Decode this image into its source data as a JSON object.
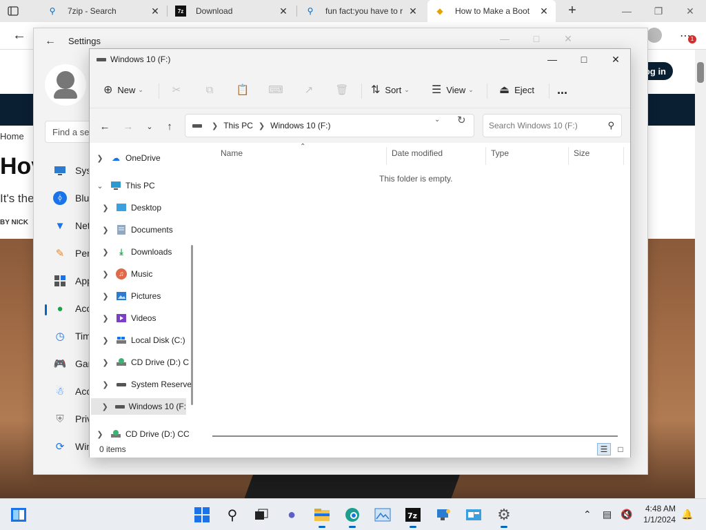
{
  "browser": {
    "tabs": [
      {
        "label": "7zip - Search",
        "favicon": "search-icon"
      },
      {
        "label": "Download",
        "favicon": "7zip-icon"
      },
      {
        "label": "fun fact:you have to r",
        "favicon": "search-icon"
      },
      {
        "label": "How to Make a Boot",
        "favicon": "htg-icon"
      }
    ],
    "login_label": "og in",
    "notification_count": "1"
  },
  "webpage": {
    "breadcrumb": "Home",
    "title_fragment": "Hov",
    "subtitle_fragment": "It's the",
    "byline_fragment": "BY NICK"
  },
  "settings": {
    "title": "Settings",
    "search_placeholder": "Find a se",
    "nav_items": [
      {
        "label": "Syst",
        "icon": "monitor-icon"
      },
      {
        "label": "Blue",
        "icon": "bluetooth-icon"
      },
      {
        "label": "Net",
        "icon": "wifi-icon"
      },
      {
        "label": "Pers",
        "icon": "brush-icon"
      },
      {
        "label": "App",
        "icon": "apps-icon"
      },
      {
        "label": "Acc",
        "icon": "person-icon"
      },
      {
        "label": "Tim",
        "icon": "clock-icon"
      },
      {
        "label": "Gar",
        "icon": "gamepad-icon"
      },
      {
        "label": "Acc",
        "icon": "accessibility-icon"
      },
      {
        "label": "Priv",
        "icon": "shield-icon"
      },
      {
        "label": "Win",
        "icon": "update-icon"
      }
    ]
  },
  "explorer": {
    "title": "Windows 10 (F:)",
    "commands": {
      "new": "New",
      "sort": "Sort",
      "view": "View",
      "eject": "Eject",
      "more": "..."
    },
    "breadcrumb": [
      "This PC",
      "Windows 10 (F:)"
    ],
    "search_placeholder": "Search Windows 10 (F:)",
    "columns": [
      "Name",
      "Date modified",
      "Type",
      "Size"
    ],
    "empty_message": "This folder is empty.",
    "status": "0 items",
    "nav_tree": [
      {
        "label": "OneDrive",
        "icon": "cloud-icon",
        "level": 0,
        "expanded": false
      },
      {
        "label": "This PC",
        "icon": "pc-icon",
        "level": 0,
        "expanded": true
      },
      {
        "label": "Desktop",
        "icon": "desktop-icon",
        "level": 1
      },
      {
        "label": "Documents",
        "icon": "documents-icon",
        "level": 1
      },
      {
        "label": "Downloads",
        "icon": "downloads-icon",
        "level": 1
      },
      {
        "label": "Music",
        "icon": "music-icon",
        "level": 1
      },
      {
        "label": "Pictures",
        "icon": "pictures-icon",
        "level": 1
      },
      {
        "label": "Videos",
        "icon": "videos-icon",
        "level": 1
      },
      {
        "label": "Local Disk (C:)",
        "icon": "local-disk-icon",
        "level": 1
      },
      {
        "label": "CD Drive (D:) C",
        "icon": "cd-drive-icon",
        "level": 1
      },
      {
        "label": "System Reserve",
        "icon": "drive-icon",
        "level": 1
      },
      {
        "label": "Windows 10 (F:",
        "icon": "drive-icon",
        "level": 1,
        "selected": true
      },
      {
        "label": "CD Drive (D:) CC",
        "icon": "cd-drive-icon",
        "level": 0
      }
    ]
  },
  "taskbar": {
    "time": "4:48 AM",
    "date": "1/1/2024"
  }
}
